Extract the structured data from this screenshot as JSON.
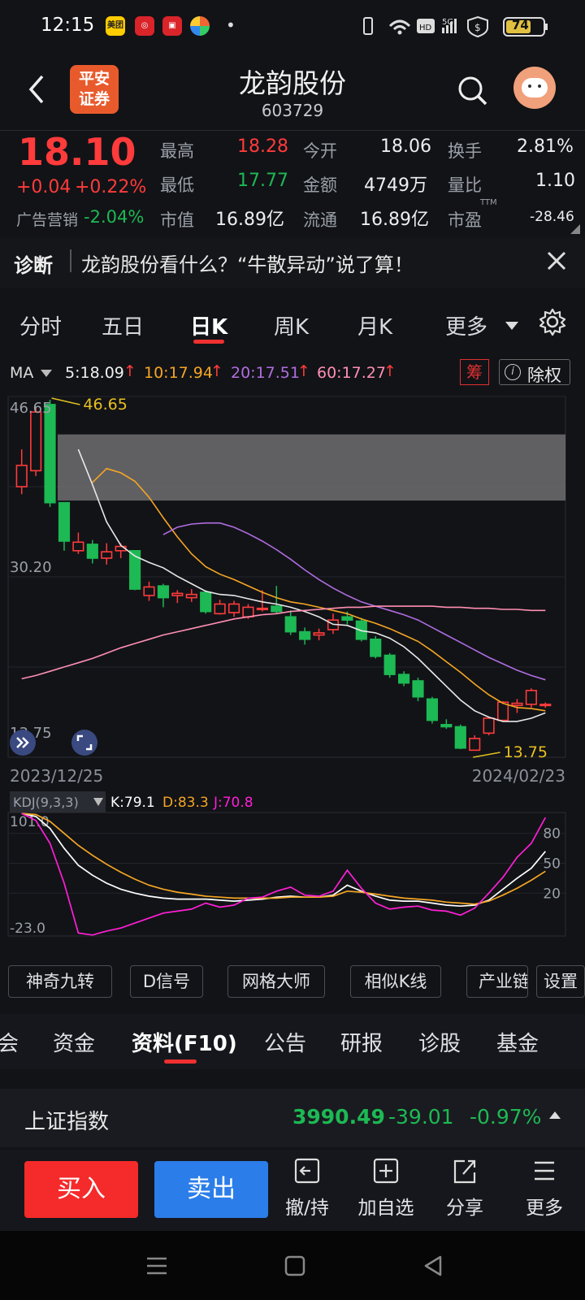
{
  "status": {
    "time": "12:15",
    "battery": "74"
  },
  "header": {
    "name": "龙韵股份",
    "code": "603729",
    "broker_line1": "平安",
    "broker_line2": "证券"
  },
  "quote": {
    "price": "18.10",
    "change": "+0.04",
    "change_pct": "+0.22%",
    "sector_label": "广告营销",
    "sector_pct": "-2.04%",
    "high_label": "最高",
    "high": "18.28",
    "low_label": "最低",
    "low": "17.77",
    "cap_label": "市值",
    "cap": "16.89亿",
    "open_label": "今开",
    "open": "18.06",
    "amount_label": "金额",
    "amount": "4749万",
    "float_label": "流通",
    "float": "16.89亿",
    "turnover_label": "换手",
    "turnover": "2.81%",
    "vol_ratio_label": "量比",
    "vol_ratio": "1.10",
    "pe_label": "市盈",
    "pe_sup": "TTM",
    "pe": "-28.46"
  },
  "diagnosis": {
    "label": "诊断",
    "text": "龙韵股份看什么？“牛散异动”说了算！"
  },
  "tabs": [
    "分时",
    "五日",
    "日K",
    "周K",
    "月K",
    "更多"
  ],
  "ma": {
    "label": "MA",
    "ma5": "5:18.09",
    "ma10": "10:17.94",
    "ma20": "20:17.51",
    "ma60": "60:17.27",
    "chip_btn": "筹",
    "exright": "除权",
    "up_arrow": "↑"
  },
  "chart_data": [
    {
      "type": "candlestick",
      "title": "",
      "y_ticks": [
        "46.65",
        "30.20",
        "13.75"
      ],
      "ylim": [
        13.75,
        46.65
      ],
      "x_start": "2023/12/25",
      "x_end": "2024/02/23",
      "annot_high": "46.65",
      "annot_low": "13.75",
      "candles": [
        [
          38.5,
          40.5,
          42.0,
          37.8
        ],
        [
          40.0,
          45.5,
          46.0,
          39.5
        ],
        [
          46.2,
          37.0,
          46.65,
          36.6
        ],
        [
          37.0,
          33.4,
          36.0,
          32.5
        ],
        [
          32.5,
          33.3,
          34.2,
          32.2
        ],
        [
          33.1,
          31.8,
          33.5,
          31.3
        ],
        [
          31.8,
          32.4,
          33.2,
          31.2
        ],
        [
          32.5,
          32.9,
          33.2,
          31.8
        ],
        [
          32.5,
          28.9,
          32.5,
          28.8
        ],
        [
          28.3,
          29.1,
          29.6,
          27.8
        ],
        [
          29.2,
          28.1,
          29.4,
          27.2
        ],
        [
          28.3,
          28.5,
          28.8,
          27.6
        ],
        [
          28.1,
          28.4,
          28.9,
          27.7
        ],
        [
          28.6,
          26.8,
          28.8,
          26.6
        ],
        [
          26.6,
          27.5,
          27.9,
          26.5
        ],
        [
          26.7,
          27.5,
          27.8,
          26.3
        ],
        [
          26.3,
          27.2,
          27.5,
          26.1
        ],
        [
          27.0,
          27.1,
          28.8,
          26.8
        ],
        [
          27.3,
          26.8,
          29.2,
          26.6
        ],
        [
          26.3,
          24.9,
          26.9,
          24.6
        ],
        [
          24.9,
          24.2,
          25.3,
          23.7
        ],
        [
          24.6,
          24.8,
          25.2,
          24.1
        ],
        [
          25.1,
          26.0,
          26.6,
          24.7
        ],
        [
          26.3,
          26.0,
          26.8,
          25.6
        ],
        [
          25.9,
          24.2,
          26.2,
          24.0
        ],
        [
          24.2,
          22.6,
          24.5,
          22.4
        ],
        [
          22.7,
          20.9,
          22.9,
          20.6
        ],
        [
          20.9,
          20.1,
          21.2,
          19.8
        ],
        [
          20.3,
          18.8,
          20.6,
          18.4
        ],
        [
          18.6,
          16.6,
          18.8,
          16.3
        ],
        [
          16.2,
          16.0,
          16.7,
          15.8
        ],
        [
          16.0,
          14.0,
          16.2,
          13.9
        ],
        [
          13.8,
          14.9,
          15.2,
          13.75
        ],
        [
          15.4,
          16.8,
          16.9,
          15.2
        ],
        [
          16.6,
          18.3,
          18.4,
          16.5
        ],
        [
          18.0,
          18.2,
          18.6,
          17.3
        ],
        [
          18.1,
          19.4,
          19.6,
          17.8
        ],
        [
          18.06,
          18.1,
          18.28,
          17.77
        ]
      ],
      "series": [
        {
          "name": "MA5",
          "color": "#e8e8e8",
          "values": [
            null,
            null,
            null,
            null,
            42.0,
            38.7,
            35.2,
            33.0,
            32.0,
            31.4,
            30.9,
            30.1,
            29.4,
            28.7,
            28.4,
            28.3,
            28.0,
            27.7,
            27.5,
            27.2,
            26.8,
            26.3,
            25.6,
            25.5,
            25.0,
            24.8,
            24.3,
            23.5,
            22.4,
            21.1,
            19.8,
            18.5,
            17.5,
            16.9,
            16.5,
            16.5,
            16.8,
            17.3
          ]
        },
        {
          "name": "MA10",
          "color": "#f5a623",
          "values": [
            null,
            null,
            null,
            null,
            null,
            38.9,
            40.2,
            39.8,
            39.0,
            37.5,
            35.6,
            33.8,
            32.2,
            31.0,
            30.3,
            29.8,
            29.2,
            28.6,
            28.1,
            27.7,
            27.5,
            27.2,
            26.9,
            26.6,
            26.1,
            25.7,
            25.2,
            24.6,
            24.0,
            23.1,
            22.1,
            21.1,
            20.0,
            19.0,
            18.2,
            17.8,
            17.7,
            17.5
          ]
        },
        {
          "name": "MA20",
          "color": "#b06de0",
          "values": [
            null,
            null,
            null,
            null,
            null,
            null,
            null,
            null,
            null,
            null,
            34.0,
            34.7,
            35.0,
            35.1,
            35.1,
            34.7,
            34.1,
            33.4,
            32.6,
            31.7,
            30.7,
            29.8,
            29.0,
            28.3,
            27.7,
            27.3,
            26.9,
            26.5,
            26.0,
            25.3,
            24.6,
            23.9,
            23.2,
            22.5,
            21.9,
            21.3,
            20.8,
            20.4
          ]
        },
        {
          "name": "MA60",
          "color": "#ff8fb3",
          "values": [
            20.5,
            20.8,
            21.2,
            21.6,
            22.0,
            22.4,
            22.9,
            23.4,
            23.8,
            24.2,
            24.6,
            24.9,
            25.2,
            25.5,
            25.8,
            26.1,
            26.3,
            26.5,
            26.6,
            26.8,
            26.9,
            27.0,
            27.1,
            27.2,
            27.2,
            27.3,
            27.3,
            27.3,
            27.3,
            27.3,
            27.2,
            27.2,
            27.1,
            27.1,
            27.0,
            27.0,
            26.9,
            26.9
          ]
        }
      ],
      "gap_zone": {
        "low": 37.2,
        "high": 43.4
      }
    },
    {
      "type": "line",
      "title": "",
      "indicator": "KDJ(9,3,3)",
      "k_label": "K:79.1",
      "d_label": "D:83.3",
      "j_label": "J:70.8",
      "ylim": [
        -23.0,
        101.0
      ],
      "y_ticks_left": [
        "101.0",
        "-23.0"
      ],
      "y_ticks_right": [
        "80",
        "50",
        "20"
      ],
      "series": [
        {
          "name": "K",
          "color": "#ffffff",
          "values": [
            100,
            97,
            85,
            65,
            48,
            38,
            30,
            24,
            20,
            17,
            15,
            14,
            14,
            14,
            13,
            12,
            13,
            14,
            16,
            17,
            16,
            16,
            18,
            28,
            22,
            17,
            13,
            12,
            12,
            10,
            8,
            7,
            8,
            13,
            24,
            35,
            45,
            62
          ]
        },
        {
          "name": "D",
          "color": "#f5a623",
          "values": [
            100,
            99,
            92,
            80,
            68,
            58,
            49,
            41,
            34,
            28,
            24,
            21,
            19,
            17,
            16,
            15,
            15,
            15,
            15,
            16,
            16,
            16,
            17,
            22,
            21,
            19,
            17,
            15,
            14,
            13,
            11,
            10,
            9,
            12,
            18,
            25,
            33,
            42
          ]
        },
        {
          "name": "J",
          "color": "#ff1fd6",
          "values": [
            100,
            93,
            70,
            30,
            -20,
            -22,
            -18,
            -15,
            -10,
            -5,
            0,
            2,
            4,
            10,
            6,
            8,
            15,
            16,
            22,
            26,
            18,
            17,
            22,
            43,
            25,
            10,
            4,
            6,
            7,
            3,
            2,
            -2,
            5,
            20,
            36,
            56,
            70,
            96
          ]
        }
      ]
    }
  ],
  "chips": [
    "神奇九转",
    "D信号",
    "网格大师",
    "相似K线",
    "产业链",
    "设置"
  ],
  "subtabs": [
    "会",
    "资金",
    "资料(F10)",
    "公告",
    "研报",
    "诊股",
    "基金"
  ],
  "index": {
    "name": "上证指数",
    "value": "3990.49",
    "change": "-39.01",
    "pct": "-0.97%"
  },
  "actions": {
    "buy": "买入",
    "sell": "卖出",
    "undo": "撤/持",
    "add": "加自选",
    "share": "分享",
    "more": "更多"
  },
  "colors": {
    "up": "#ff3b3b",
    "down": "#1db954",
    "buy": "#f52a2a",
    "sell": "#2b7de9"
  }
}
